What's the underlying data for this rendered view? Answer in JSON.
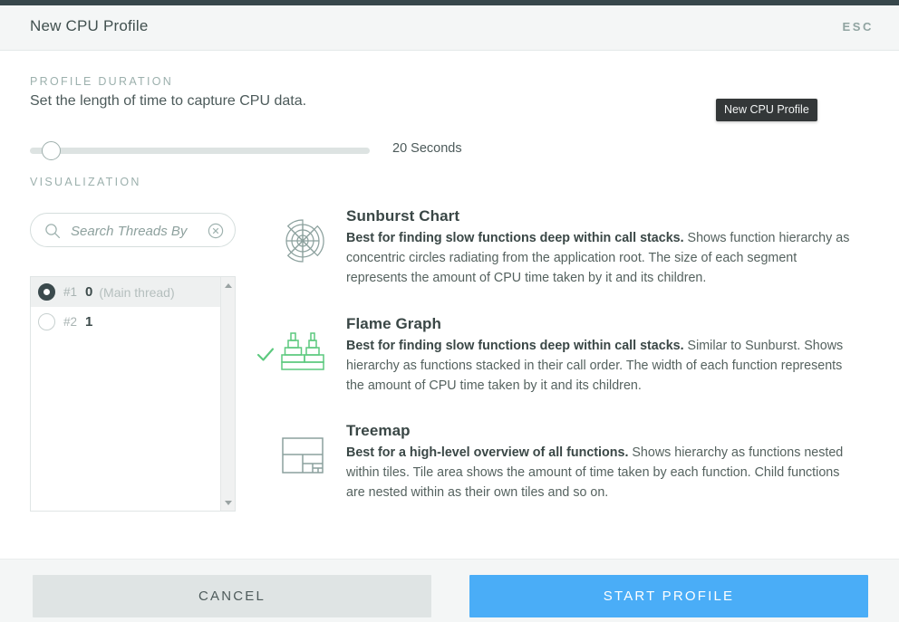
{
  "window": {
    "title": "New CPU Profile",
    "esc_label": "ESC"
  },
  "tooltip": {
    "text": "New CPU Profile"
  },
  "duration": {
    "section_label": "PROFILE DURATION",
    "description": "Set the length of time to capture CPU data.",
    "slider_value_label": "20 Seconds",
    "slider_seconds": 20
  },
  "visualization": {
    "section_label": "VISUALIZATION",
    "search": {
      "placeholder": "Search Threads By",
      "value": "",
      "search_icon": "search-icon",
      "clear_icon": "clear-circle-icon"
    },
    "threads": [
      {
        "index": "#1",
        "id": "0",
        "note": "(Main thread)",
        "selected": true
      },
      {
        "index": "#2",
        "id": "1",
        "note": "",
        "selected": false
      }
    ],
    "options": [
      {
        "id": "sunburst",
        "icon": "sunburst-chart-icon",
        "title": "Sunburst Chart",
        "lede": "Best for finding slow functions deep within call stacks.",
        "body": " Shows function hierarchy as concentric circles radiating from the application root. The size of each segment represents the amount of CPU time taken by it and its children.",
        "selected": false
      },
      {
        "id": "flame",
        "icon": "flame-graph-icon",
        "title": "Flame Graph",
        "lede": "Best for finding slow functions deep within call stacks.",
        "body": " Similar to Sunburst. Shows hierarchy as functions stacked in their call order. The width of each function represents the amount of CPU time taken by it and its children.",
        "selected": true
      },
      {
        "id": "treemap",
        "icon": "treemap-icon",
        "title": "Treemap",
        "lede": "Best for a high-level overview of all functions.",
        "body": " Shows hierarchy as functions nested within tiles. Tile area shows the amount of time taken by each function. Child functions are nested within as their own tiles and so on.",
        "selected": false
      }
    ]
  },
  "footer": {
    "cancel_label": "CANCEL",
    "start_label": "START PROFILE"
  },
  "colors": {
    "accent_blue": "#4aadf7",
    "selected_green": "#5cc97e",
    "icon_gray": "#8ba09d",
    "header_bg": "#f4f6f6",
    "top_strip": "#37474b"
  }
}
